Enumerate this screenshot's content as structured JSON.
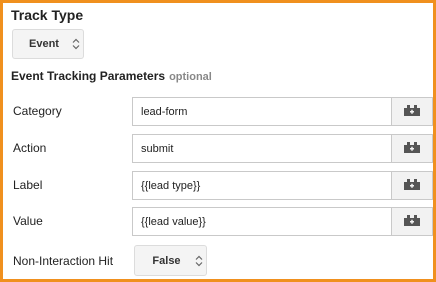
{
  "track_type": {
    "title": "Track Type",
    "selected": "Event"
  },
  "params": {
    "title": "Event Tracking Parameters",
    "optional_label": "optional",
    "rows": [
      {
        "label": "Category",
        "value": "lead-form",
        "variable_icon": "variable-brick-icon"
      },
      {
        "label": "Action",
        "value": "submit",
        "variable_icon": "variable-brick-icon"
      },
      {
        "label": "Label",
        "value": "{{lead type}}",
        "variable_icon": "variable-brick-icon"
      },
      {
        "label": "Value",
        "value": "{{lead value}}",
        "variable_icon": "variable-brick-icon"
      }
    ]
  },
  "non_interaction": {
    "label": "Non-Interaction Hit",
    "selected": "False"
  },
  "colors": {
    "frame_border": "#f0901e",
    "optional_text": "#888888"
  }
}
